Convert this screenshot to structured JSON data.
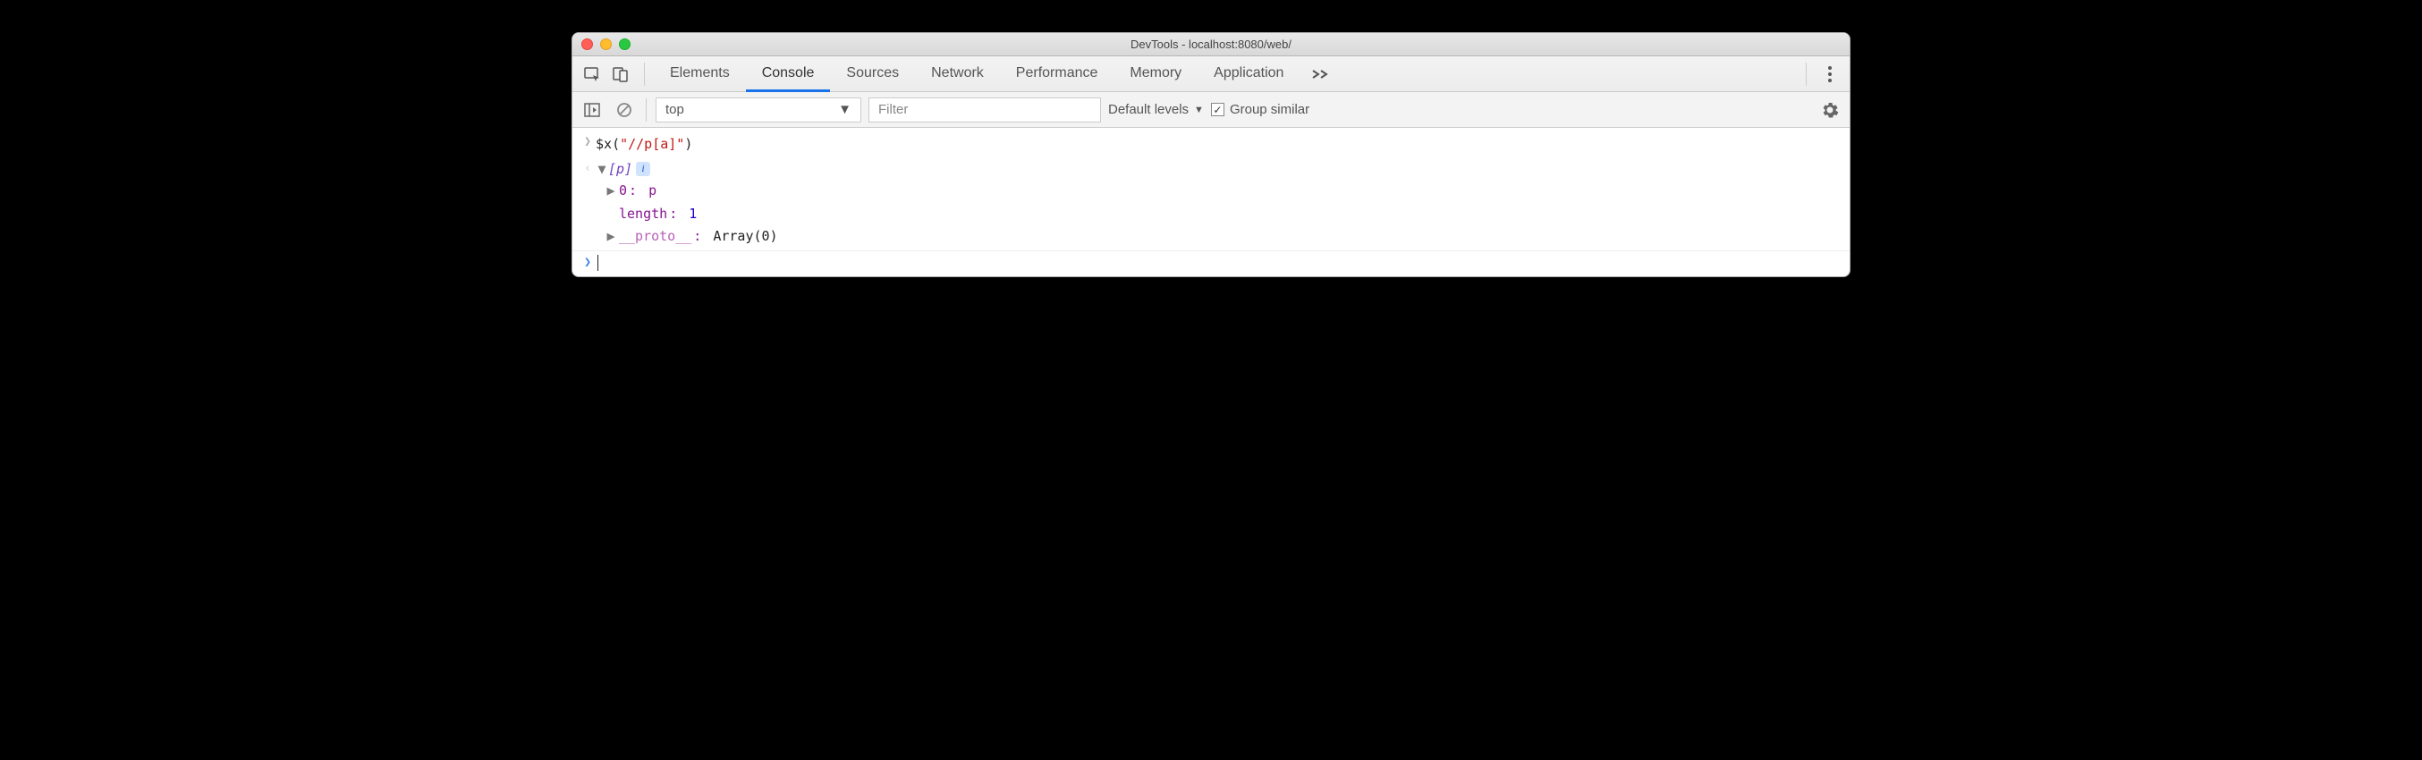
{
  "window": {
    "title": "DevTools - localhost:8080/web/"
  },
  "tabs": {
    "items": [
      "Elements",
      "Console",
      "Sources",
      "Network",
      "Performance",
      "Memory",
      "Application"
    ],
    "active_index": 1
  },
  "filterbar": {
    "context": "top",
    "filter_placeholder": "Filter",
    "levels_label": "Default levels",
    "group_similar_label": "Group similar",
    "group_similar_checked": true
  },
  "console": {
    "input_command_fn": "$x",
    "input_command_arg": "\"//p[a]\"",
    "result_summary": "[p]",
    "tree": {
      "index0_key": "0",
      "index0_val": "p",
      "length_key": "length",
      "length_val": "1",
      "proto_key": "__proto__",
      "proto_val": "Array(0)"
    }
  }
}
